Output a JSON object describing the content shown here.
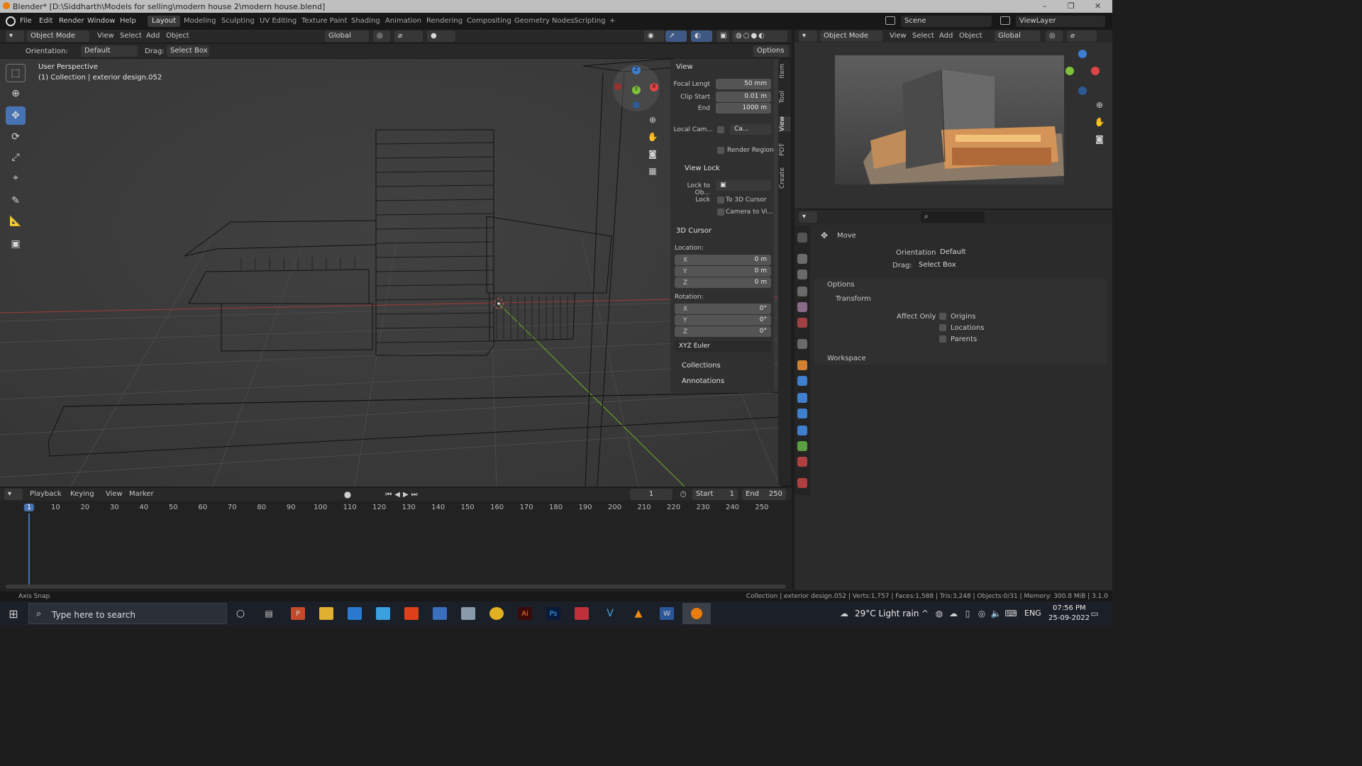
{
  "window": {
    "title": "Blender* [D:\\Siddharth\\Models for selling\\modern house 2\\modern house.blend]",
    "minimize": "–",
    "maximize": "❐",
    "close": "✕"
  },
  "menus": [
    "File",
    "Edit",
    "Render",
    "Window",
    "Help"
  ],
  "workspaces": [
    "Layout",
    "Modeling",
    "Sculpting",
    "UV Editing",
    "Texture Paint",
    "Shading",
    "Animation",
    "Rendering",
    "Compositing",
    "Geometry Nodes",
    "Scripting",
    "+"
  ],
  "scene": {
    "scene_name": "Scene",
    "view_layer": "ViewLayer"
  },
  "viewport_header": {
    "mode": "Object Mode",
    "menus": [
      "View",
      "Select",
      "Add",
      "Object"
    ],
    "transform": "Global"
  },
  "tool_settings": {
    "orientation_label": "Orientation:",
    "orientation_value": "Default",
    "drag_label": "Drag:",
    "drag_value": "Select Box",
    "options": "Options"
  },
  "viewport": {
    "perspective": "User Perspective",
    "collection": "(1) Collection | exterior design.052"
  },
  "npanel": {
    "view_title": "View",
    "focal_label": "Focal Lengt",
    "focal_value": "50 mm",
    "clip_start_label": "Clip Start",
    "clip_start_value": "0.01 m",
    "end_label": "End",
    "end_value": "1000 m",
    "local_cam_label": "Local Cam...",
    "local_cam_value": "Ca...",
    "render_region": "Render Region",
    "view_lock_title": "View Lock",
    "lock_obj_label": "Lock to Ob...",
    "lock_label": "Lock",
    "to_cursor": "To 3D Cursor",
    "camera_to_view": "Camera to Vi...",
    "cursor_title": "3D Cursor",
    "location_label": "Location:",
    "loc_x": "0 m",
    "loc_y": "0 m",
    "loc_z": "0 m",
    "rotation_label": "Rotation:",
    "rot_x": "0°",
    "rot_y": "0°",
    "rot_z": "0°",
    "rot_mode": "XYZ Euler",
    "x": "X",
    "y": "Y",
    "z": "Z",
    "collections": "Collections",
    "annotations": "Annotations"
  },
  "side_tabs": [
    "Item",
    "Tool",
    "View",
    "PDT",
    "Create"
  ],
  "right_header": {
    "mode": "Object Mode",
    "menus": [
      "View",
      "Select",
      "Add",
      "Object"
    ],
    "transform": "Global"
  },
  "properties": {
    "search_placeholder": "",
    "tool_name": "Move",
    "orientation_label": "Orientation",
    "orientation_value": "Default",
    "drag_label": "Drag:",
    "drag_value": "Select Box",
    "options": "Options",
    "transform": "Transform",
    "affect_only": "Affect Only",
    "origins": "Origins",
    "locations": "Locations",
    "parents": "Parents",
    "workspace": "Workspace"
  },
  "timeline": {
    "menus": [
      "Playback",
      "Keying",
      "View",
      "Marker"
    ],
    "current_frame": "1",
    "start_label": "Start",
    "start_value": "1",
    "end_label": "End",
    "end_value": "250",
    "ruler": [
      "1",
      "10",
      "20",
      "30",
      "40",
      "50",
      "60",
      "70",
      "80",
      "90",
      "100",
      "110",
      "120",
      "130",
      "140",
      "150",
      "160",
      "170",
      "180",
      "190",
      "200",
      "210",
      "220",
      "230",
      "240",
      "250"
    ]
  },
  "statusbar": {
    "left": "Axis Snap",
    "right": "Collection | exterior design.052 | Verts:1,757 | Faces:1,588 | Tris:3,248 | Objects:0/31 | Memory: 300.8 MiB | 3.1.0"
  },
  "taskbar": {
    "search_placeholder": "Type here to search",
    "weather": "29°C  Light rain",
    "lang": "ENG",
    "time": "07:56 PM",
    "date": "25-09-2022"
  },
  "colors": {
    "accent": "#4772b3",
    "x_axis": "#e04545",
    "y_axis": "#7ec03a",
    "z_axis": "#3f7fd0",
    "timeline_cursor": "#4772b3"
  }
}
